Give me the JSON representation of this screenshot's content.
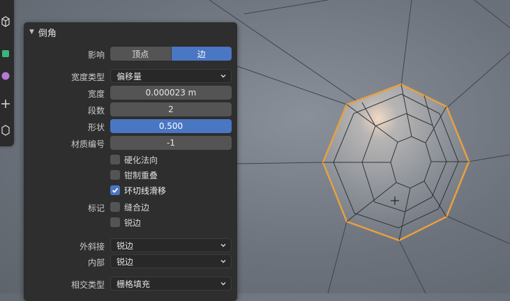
{
  "panel": {
    "title": "倒角",
    "affect": {
      "label": "影响",
      "options": [
        "顶点",
        "边"
      ],
      "selected": "边"
    },
    "width_type": {
      "label": "宽度类型",
      "value": "偏移量"
    },
    "width": {
      "label": "宽度",
      "value": "0.000023 m"
    },
    "segments": {
      "label": "段数",
      "value": "2"
    },
    "shape": {
      "label": "形状",
      "value": "0.500"
    },
    "material_index": {
      "label": "材质编号",
      "value": "-1"
    },
    "harden_normals": {
      "label": "硬化法向",
      "checked": false
    },
    "clamp_overlap": {
      "label": "钳制重叠",
      "checked": false
    },
    "loop_slide": {
      "label": "环切线滑移",
      "checked": true
    },
    "mark": {
      "label": "标记",
      "seam": {
        "label": "缝合边",
        "checked": false
      },
      "sharp": {
        "label": "锐边",
        "checked": false
      }
    },
    "miter_outer": {
      "label": "外斜接",
      "value": "锐边"
    },
    "miter_inner": {
      "label": "内部",
      "value": "锐边"
    },
    "intersection_type": {
      "label": "相交类型",
      "value": "栅格填充"
    }
  },
  "colors": {
    "accent": "#4a77c4",
    "selection_edge": "#e8a040",
    "panel_bg": "#2e2e2e"
  }
}
